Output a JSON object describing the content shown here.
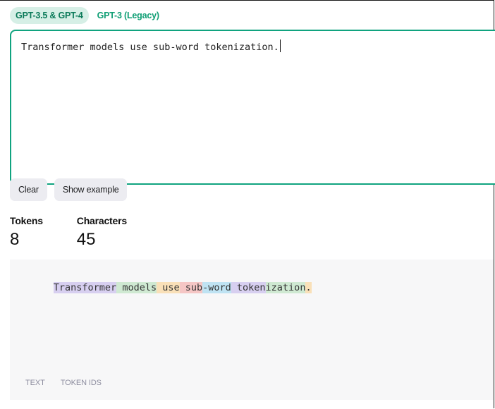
{
  "model_tabs": [
    {
      "label": "GPT-3.5 & GPT-4",
      "active": true
    },
    {
      "label": "GPT-3 (Legacy)",
      "active": false
    }
  ],
  "editor": {
    "value": "Transformer models use sub-word tokenization."
  },
  "buttons": {
    "clear_label": "Clear",
    "example_label": "Show example"
  },
  "stats": {
    "tokens_label": "Tokens",
    "tokens_value": "8",
    "characters_label": "Characters",
    "characters_value": "45"
  },
  "tokenized": {
    "tokens": [
      {
        "text": "Transformer",
        "color": "#d7cff0"
      },
      {
        "text": " models",
        "color": "#cfe9d2"
      },
      {
        "text": " use",
        "color": "#f9e0b8"
      },
      {
        "text": " sub",
        "color": "#f5c6c5"
      },
      {
        "text": "-word",
        "color": "#bfe3f3"
      },
      {
        "text": " token",
        "color": "#d7cff0"
      },
      {
        "text": "ization",
        "color": "#cfe9d2"
      },
      {
        "text": ".",
        "color": "#f9e0b8"
      }
    ]
  },
  "view_tabs": {
    "text_label": "TEXT",
    "token_ids_label": "TOKEN IDS"
  },
  "colors": {
    "accent": "#10a37f",
    "active_tab_bg": "#d6efe6"
  }
}
